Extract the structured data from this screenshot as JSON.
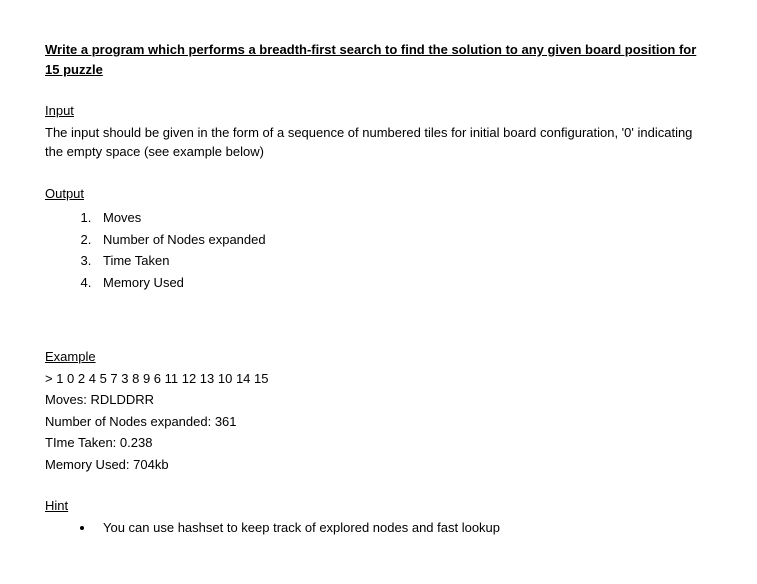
{
  "title": "Write a program which performs a breadth-first search to find the solution to any given board position for 15 puzzle",
  "input": {
    "heading": "Input",
    "text": "The input should be given in the form of a sequence of numbered tiles for initial board configuration, '0' indicating the empty space (see example below)"
  },
  "output": {
    "heading": "Output",
    "items": [
      "Moves",
      "Number of Nodes expanded",
      "Time Taken",
      "Memory Used"
    ]
  },
  "example": {
    "heading": "Example",
    "input_line": "> 1 0 2 4 5 7 3 8 9 6 11 12 13 10 14 15",
    "moves": "Moves: RDLDDRR",
    "nodes": "Number of Nodes expanded: 361",
    "time": "TIme Taken: 0.238",
    "memory": "Memory Used:  704kb"
  },
  "hint": {
    "heading": "Hint",
    "items": [
      "You can use hashset to keep track of explored nodes and fast lookup"
    ]
  }
}
